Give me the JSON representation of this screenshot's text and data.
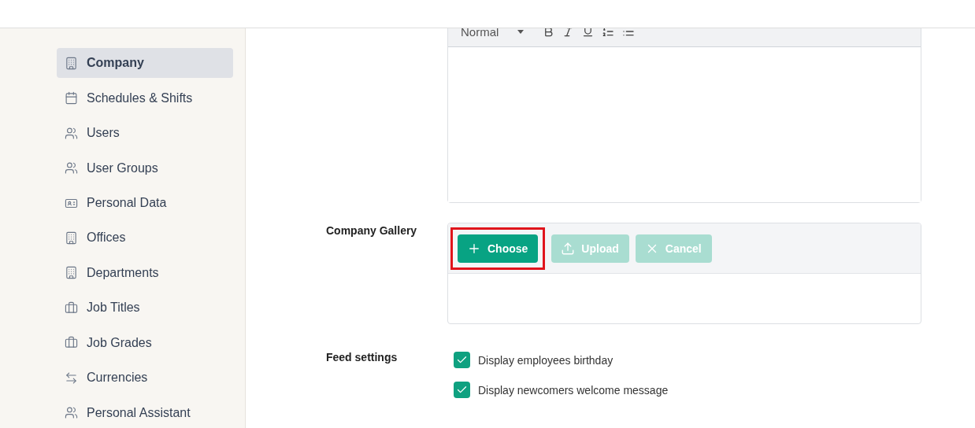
{
  "sidebar": {
    "items": [
      {
        "label": "Company",
        "selected": true
      },
      {
        "label": "Schedules & Shifts",
        "selected": false
      },
      {
        "label": "Users",
        "selected": false
      },
      {
        "label": "User Groups",
        "selected": false
      },
      {
        "label": "Personal Data",
        "selected": false
      },
      {
        "label": "Offices",
        "selected": false
      },
      {
        "label": "Departments",
        "selected": false
      },
      {
        "label": "Job Titles",
        "selected": false
      },
      {
        "label": "Job Grades",
        "selected": false
      },
      {
        "label": "Currencies",
        "selected": false
      },
      {
        "label": "Personal Assistant",
        "selected": false
      }
    ]
  },
  "editor": {
    "format": "Normal"
  },
  "gallery": {
    "label": "Company Gallery",
    "buttons": [
      {
        "label": "Choose",
        "kind": "add",
        "disabled": false,
        "highlighted": true
      },
      {
        "label": "Upload",
        "kind": "upload",
        "disabled": true,
        "highlighted": false
      },
      {
        "label": "Cancel",
        "kind": "cancel",
        "disabled": true,
        "highlighted": false
      }
    ]
  },
  "feed": {
    "label": "Feed settings",
    "options": [
      {
        "label": "Display employees birthday",
        "checked": true
      },
      {
        "label": "Display newcomers welcome message",
        "checked": true
      }
    ]
  }
}
